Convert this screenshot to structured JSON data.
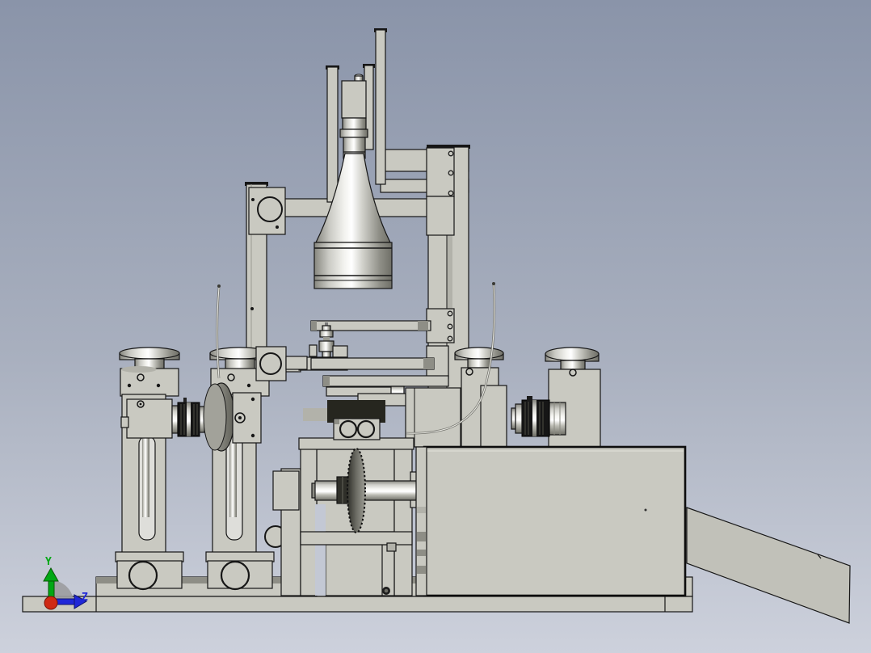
{
  "viewport": {
    "kind": "3d-cad-render-side-view",
    "axis_triad": {
      "y_label": "Y",
      "z_label": "Z"
    },
    "colors": {
      "background_top": "#8a94a9",
      "background_mid": "#a9b0bf",
      "background_bottom": "#cdd1dc",
      "part_light": "#c9c9c1",
      "part_mid": "#b2b2aa",
      "part_dark": "#8e8e86",
      "deep_shadow": "#26261f",
      "outline": "#161616",
      "lens_black": "#161616",
      "metal_highlight": "#ffffff",
      "metal_shade": "#6f6f67",
      "axis_y_green": "#00a814",
      "axis_z_blue": "#1f27d8",
      "origin_red": "#cf2a14",
      "axis_plane_gray": "#9b9ca0"
    },
    "parts": [
      "base-plate-stack",
      "left-lift-stage-1",
      "left-lift-stage-2",
      "side-camera-left",
      "backlight-disc",
      "support-post",
      "gantry-beams",
      "vertical-rail-right",
      "work-stage-rails",
      "nozzle-valve",
      "inspection-recess",
      "roller-block",
      "lower-frame",
      "index-wheel",
      "drive-shaft",
      "right-lift-stage-1",
      "right-lift-stage-2",
      "side-camera-right",
      "top-camera",
      "lens-cone",
      "electronics-enclosure",
      "exit-ramp",
      "signal-cables",
      "origin-triad"
    ]
  }
}
